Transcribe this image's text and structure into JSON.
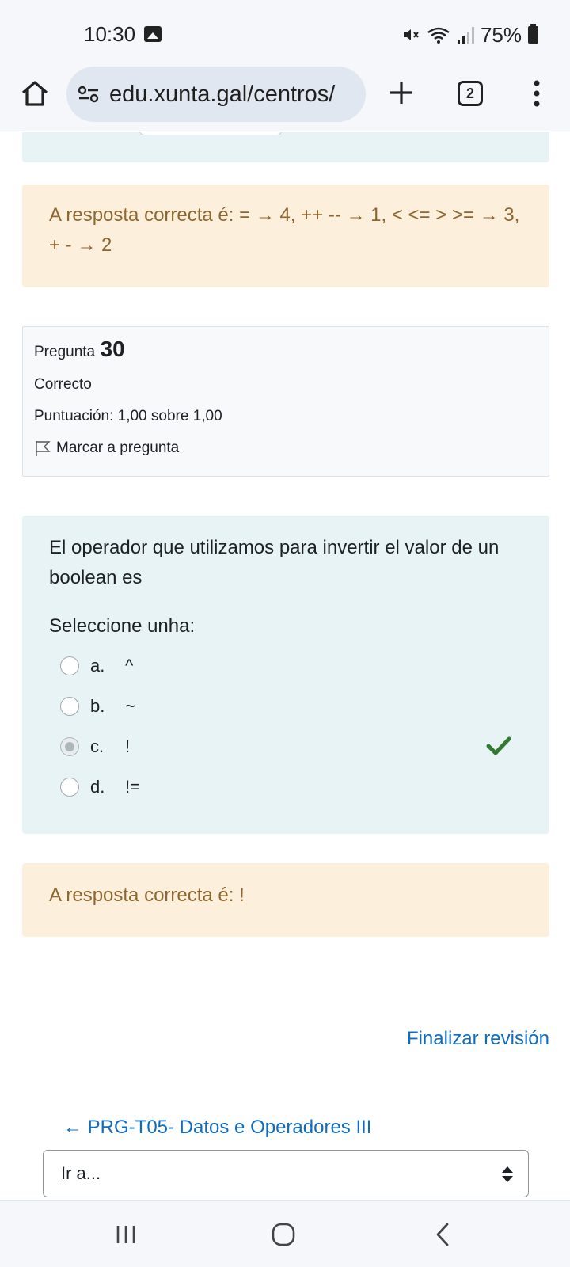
{
  "status_bar": {
    "time": "10:30",
    "battery": "75%",
    "icons": [
      "image-icon",
      "mute-icon",
      "wifi-icon",
      "signal-icon",
      "battery-icon"
    ]
  },
  "browser": {
    "url": "edu.xunta.gal/centros/",
    "tab_count": "2",
    "icons": [
      "home-icon",
      "site-settings-icon",
      "plus-icon",
      "more-vert-icon"
    ]
  },
  "previous_feedback": {
    "text": "A resposta correcta é: = → 4, ++ -- → 1, < <= > >= → 3, + - → 2"
  },
  "question_info": {
    "label": "Pregunta",
    "number": "30",
    "state": "Correcto",
    "grade": "Puntuación: 1,00 sobre 1,00",
    "flag_label": "Marcar a pregunta"
  },
  "question": {
    "text": "El operador que utilizamos para invertir el valor de un boolean es",
    "prompt": "Seleccione unha:",
    "answers": [
      {
        "letter": "a.",
        "text": "^",
        "selected": false,
        "correct": false
      },
      {
        "letter": "b.",
        "text": "~",
        "selected": false,
        "correct": false
      },
      {
        "letter": "c.",
        "text": "!",
        "selected": true,
        "correct": true
      },
      {
        "letter": "d.",
        "text": "!=",
        "selected": false,
        "correct": false
      }
    ]
  },
  "feedback": {
    "text": "A resposta correcta é: !"
  },
  "navigation": {
    "finish": "Finalizar revisión",
    "previous": "← PRG-T05- Datos e Operadores III",
    "goto_select": "Ir a..."
  },
  "colors": {
    "accent_link": "#0f6cbf",
    "correct_check": "#357a32",
    "feedback_bg": "#fcefdc",
    "question_bg": "#e7f3f5"
  }
}
